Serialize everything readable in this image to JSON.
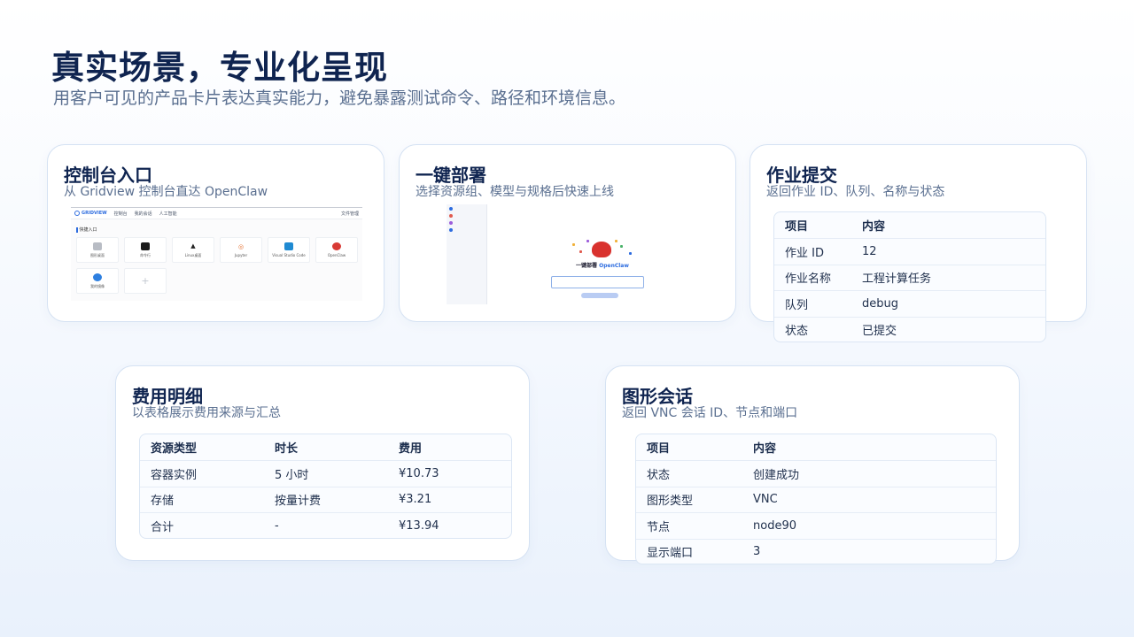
{
  "page": {
    "title": "真实场景，专业化呈现",
    "subtitle": "用客户可见的产品卡片表达真实能力，避免暴露测试命令、路径和环境信息。"
  },
  "cards": {
    "console": {
      "title": "控制台入口",
      "subtitle": "从 Gridview 控制台直达 OpenClaw",
      "screenshot": {
        "brand": "GRIDVIEW",
        "nav_items": [
          "控制台",
          "我的会话",
          "人工智能"
        ],
        "nav_right": "文件管理",
        "section_label": "快捷入口",
        "tiles": [
          "图形桌面",
          "命令行",
          "Linux桌面",
          "Jupyter",
          "Visual Studio Code",
          "OpenClaw",
          "我的镜像"
        ]
      }
    },
    "deploy": {
      "title": "一键部署",
      "subtitle": "选择资源组、模型与规格后快速上线",
      "screenshot": {
        "heading_prefix": "一键部署",
        "heading_brand": "OpenClaw"
      }
    },
    "job": {
      "title": "作业提交",
      "subtitle": "返回作业 ID、队列、名称与状态",
      "table": {
        "headers": [
          "项目",
          "内容"
        ],
        "rows": [
          [
            "作业 ID",
            "12"
          ],
          [
            "作业名称",
            "工程计算任务"
          ],
          [
            "队列",
            "debug"
          ],
          [
            "状态",
            "已提交"
          ]
        ]
      }
    },
    "cost": {
      "title": "费用明细",
      "subtitle": "以表格展示费用来源与汇总",
      "table": {
        "headers": [
          "资源类型",
          "时长",
          "费用"
        ],
        "rows": [
          [
            "容器实例",
            "5 小时",
            "¥10.73"
          ],
          [
            "存储",
            "按量计费",
            "¥3.21"
          ],
          [
            "合计",
            "-",
            "¥13.94"
          ]
        ]
      }
    },
    "vnc": {
      "title": "图形会话",
      "subtitle": "返回 VNC 会话 ID、节点和端口",
      "table": {
        "headers": [
          "项目",
          "内容"
        ],
        "rows": [
          [
            "状态",
            "创建成功"
          ],
          [
            "图形类型",
            "VNC"
          ],
          [
            "节点",
            "node90"
          ],
          [
            "显示端口",
            "3"
          ]
        ]
      }
    }
  },
  "colors": {
    "title": "#0f2450",
    "subtitle": "#5a6f90",
    "accent": "#2d6cdf",
    "card_border": "#d5e2f3"
  }
}
